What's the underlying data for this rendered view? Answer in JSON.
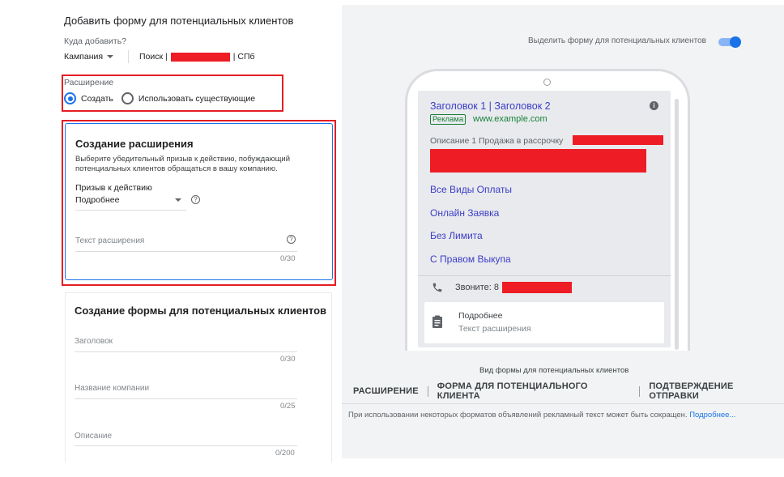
{
  "form": {
    "title": "Добавить форму для потенциальных клиентов",
    "destination_label": "Куда добавить?",
    "campaign_select": "Кампания",
    "campaign_name_prefix": "Поиск |",
    "campaign_name_suffix": "| СПб"
  },
  "extension": {
    "label": "Расширение",
    "options": [
      {
        "label": "Создать",
        "selected": true
      },
      {
        "label": "Использовать существующие",
        "selected": false
      }
    ]
  },
  "create_extension": {
    "title": "Создание расширения",
    "description": "Выберите убедительный призыв к действию, побуждающий потенциальных клиентов обращаться в вашу компанию.",
    "cta_label": "Призыв к действию",
    "cta_value": "Подробнее",
    "help_symbol": "?",
    "ext_text_placeholder": "Текст расширения",
    "ext_text_counter": "0/30"
  },
  "lead_form": {
    "title": "Создание формы для потенциальных клиентов",
    "fields": [
      {
        "label": "Заголовок",
        "counter": "0/30"
      },
      {
        "label": "Название компании",
        "counter": "0/25"
      },
      {
        "label": "Описание",
        "counter": "0/200"
      }
    ]
  },
  "preview": {
    "toggle_label": "Выделить форму для потенциальных клиентов",
    "toggle_on": true,
    "ad_headline": "Заголовок 1 | Заголовок 2",
    "ad_badge": "Реклама",
    "ad_url": "www.example.com",
    "ad_description": "Описание 1 Продажа в рассрочку",
    "sitelinks": [
      "Все Виды Оплаты",
      "Онлайн Заявка",
      "Без Лимита",
      "С Правом Выкупа"
    ],
    "call_text": "Звоните: 8",
    "ext_preview_title": "Подробнее",
    "ext_preview_sub": "Текст расширения",
    "view_label": "Вид формы для потенциальных клиентов",
    "tabs": [
      "РАСШИРЕНИЕ",
      "ФОРМА ДЛЯ ПОТЕНЦИАЛЬНОГО КЛИЕНТА",
      "ПОДТВЕРЖДЕНИЕ ОТПРАВКИ"
    ],
    "footnote": "При использовании некоторых форматов объявлений рекламный текст может быть сокращен.",
    "footnote_link": "Подробнее..."
  },
  "colors": {
    "accent": "#1a73e8",
    "redaction": "#ee1c25",
    "highlight_border": "#e51c23",
    "ad_link": "#3c3cc7",
    "ad_green": "#188038"
  },
  "icons": [
    "chevron-down-icon",
    "help-icon",
    "info-icon",
    "phone-icon",
    "clipboard-icon",
    "toggle-switch"
  ]
}
